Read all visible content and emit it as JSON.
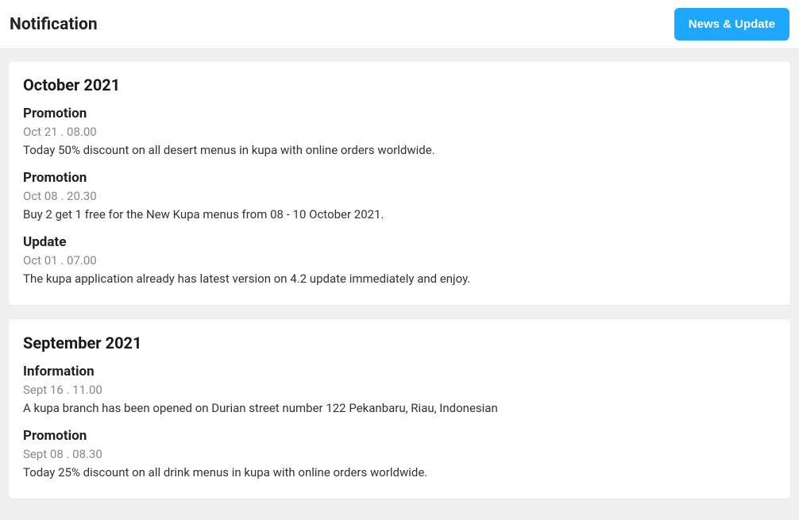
{
  "header": {
    "title": "Notification",
    "button": "News & Update"
  },
  "groups": [
    {
      "title": "October 2021",
      "items": [
        {
          "title": "Promotion",
          "date": "Oct 21 . 08.00",
          "body": "Today 50% discount on all desert menus in kupa with online orders worldwide."
        },
        {
          "title": "Promotion",
          "date": "Oct 08 . 20.30",
          "body": "Buy 2 get 1 free for the New Kupa menus from 08 - 10 October 2021."
        },
        {
          "title": "Update",
          "date": "Oct 01 . 07.00",
          "body": "The kupa application already has latest version on 4.2 update immediately and enjoy."
        }
      ]
    },
    {
      "title": "September 2021",
      "items": [
        {
          "title": "Information",
          "date": "Sept 16 . 11.00",
          "body": "A kupa branch has been opened on Durian street number 122 Pekanbaru, Riau, Indonesian"
        },
        {
          "title": "Promotion",
          "date": "Sept 08 . 08.30",
          "body": "Today 25% discount on all drink menus in kupa with online orders worldwide."
        }
      ]
    }
  ]
}
